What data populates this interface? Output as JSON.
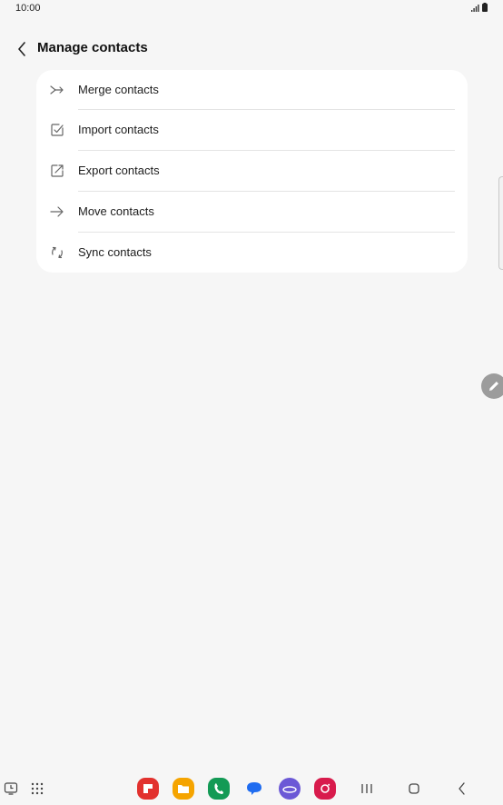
{
  "status_bar": {
    "time": "10:00"
  },
  "header": {
    "title": "Manage contacts"
  },
  "menu": [
    {
      "label": "Merge contacts",
      "icon": "merge-icon"
    },
    {
      "label": "Import contacts",
      "icon": "import-icon"
    },
    {
      "label": "Export contacts",
      "icon": "export-icon"
    },
    {
      "label": "Move contacts",
      "icon": "arrow-right-icon"
    },
    {
      "label": "Sync contacts",
      "icon": "sync-icon"
    }
  ],
  "taskbar": {
    "apps": [
      {
        "name": "flipboard-app-icon",
        "color": "#e2312e"
      },
      {
        "name": "my-files-app-icon",
        "color": "#f5a400"
      },
      {
        "name": "phone-app-icon",
        "color": "#139a55"
      },
      {
        "name": "messages-app-icon",
        "color": "#1f6cf0"
      },
      {
        "name": "internet-app-icon",
        "color": "#6b58d6"
      },
      {
        "name": "camera-app-icon",
        "color": "#d81b4c"
      }
    ]
  },
  "colors": {
    "background": "#f6f6f6",
    "card": "#ffffff",
    "fab": "#9c9c9c"
  }
}
